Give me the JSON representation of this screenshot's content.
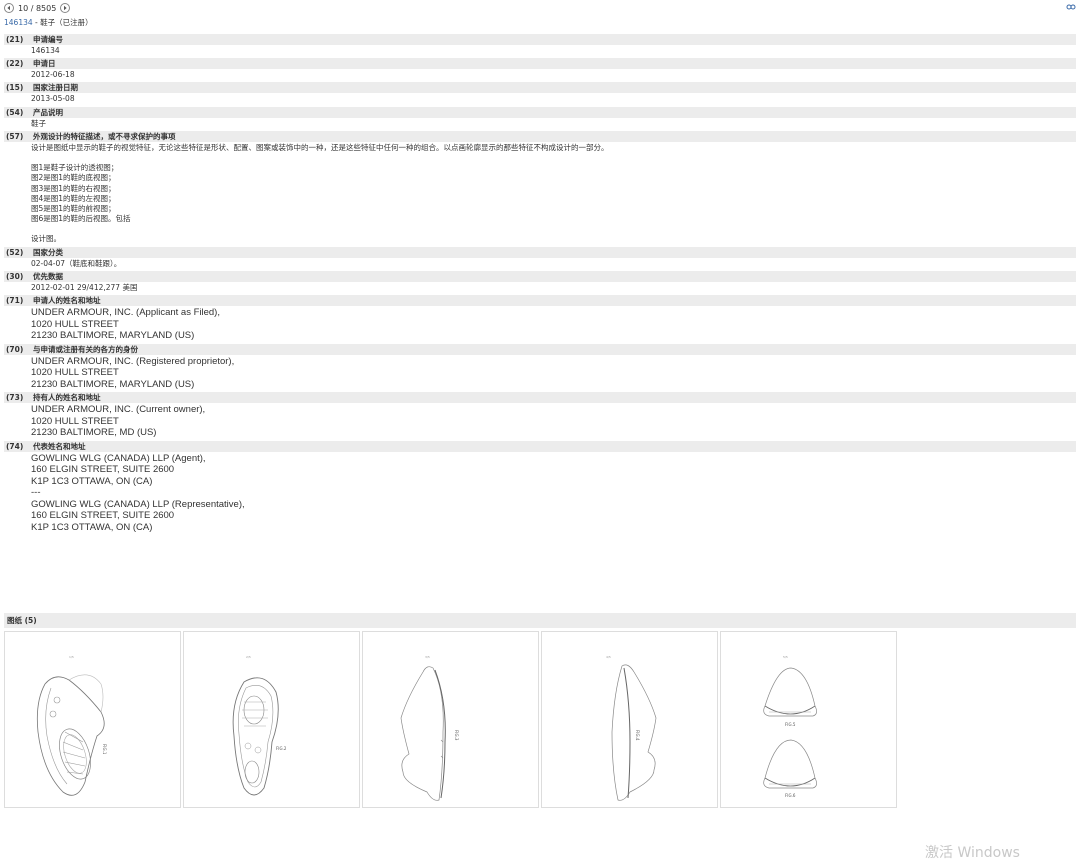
{
  "nav": {
    "counter": "10 / 8505"
  },
  "record": {
    "id": "146134",
    "title_rest": " - 鞋子（已注册）"
  },
  "fields": [
    {
      "code": "(21)",
      "label": "申请编号",
      "lang": "cn",
      "lines": [
        "146134"
      ]
    },
    {
      "code": "(22)",
      "label": "申请日",
      "lang": "cn",
      "lines": [
        "2012-06-18"
      ]
    },
    {
      "code": "(15)",
      "label": "国家注册日期",
      "lang": "cn",
      "lines": [
        "2013-05-08"
      ]
    },
    {
      "code": "(54)",
      "label": "产品说明",
      "lang": "cn",
      "lines": [
        "鞋子"
      ]
    },
    {
      "code": "(57)",
      "label": "外观设计的特征描述，或不寻求保护的事项",
      "lang": "cn",
      "lines": [
        "设计是图纸中显示的鞋子的视觉特征，无论这些特征是形状、配置、图案或装饰中的一种，还是这些特征中任何一种的组合。以点画轮廓显示的那些特征不构成设计的一部分。",
        "",
        "图1是鞋子设计的透视图；",
        "图2是图1的鞋的底视图；",
        "图3是图1的鞋的右视图；",
        "图4是图1的鞋的左视图；",
        "图5是图1的鞋的前视图；",
        "图6是图1的鞋的后视图。包括",
        "",
        "设计图。"
      ]
    },
    {
      "code": "(52)",
      "label": "国家分类",
      "lang": "cn",
      "lines": [
        "02-04-07（鞋底和鞋跟）。"
      ]
    },
    {
      "code": "(30)",
      "label": "优先数据",
      "lang": "cn",
      "lines": [
        "2012-02-01 29/412,277 美国"
      ]
    },
    {
      "code": "(71)",
      "label": "申请人的姓名和地址",
      "lang": "en",
      "lines": [
        "UNDER ARMOUR, INC. (Applicant as Filed),",
        "1020 HULL STREET",
        "21230 BALTIMORE, MARYLAND (US)"
      ]
    },
    {
      "code": "(70)",
      "label": "与申请或注册有关的各方的身份",
      "lang": "en",
      "lines": [
        "UNDER ARMOUR, INC. (Registered proprietor),",
        "1020 HULL STREET",
        "21230 BALTIMORE, MARYLAND (US)"
      ]
    },
    {
      "code": "(73)",
      "label": "持有人的姓名和地址",
      "lang": "en",
      "lines": [
        "UNDER ARMOUR, INC. (Current owner),",
        "1020 HULL STREET",
        "21230 BALTIMORE, MD (US)"
      ]
    },
    {
      "code": "(74)",
      "label": "代表姓名和地址",
      "lang": "en",
      "lines": [
        "GOWLING WLG (CANADA) LLP (Agent),",
        "160 ELGIN STREET, SUITE 2600",
        "K1P 1C3 OTTAWA, ON (CA)",
        "---",
        "GOWLING WLG (CANADA) LLP (Representative),",
        "160 ELGIN STREET, SUITE 2600",
        "K1P 1C3 OTTAWA, ON (CA)"
      ]
    }
  ],
  "gallery": {
    "header": "图纸 (5)",
    "items": [
      {
        "fig": "FIG.1"
      },
      {
        "fig": "FIG.2"
      },
      {
        "fig": "FIG.3"
      },
      {
        "fig": "FIG.4"
      },
      {
        "fig": "FIG.5",
        "fig2": "FIG.6"
      }
    ]
  },
  "watermark": "激活 Windows"
}
